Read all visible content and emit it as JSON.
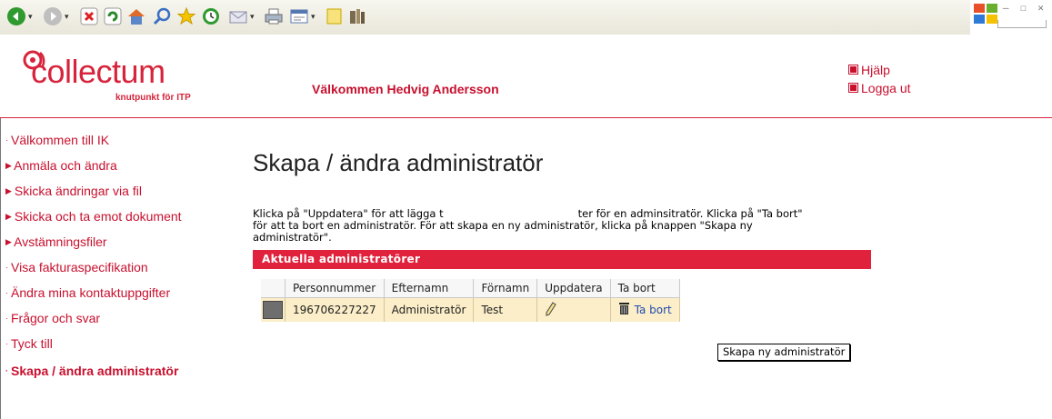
{
  "toolbar": {
    "icons": [
      "back-icon",
      "forward-icon",
      "stop-icon",
      "refresh-icon",
      "home-icon",
      "search-icon",
      "favorites-icon",
      "history-icon",
      "mail-icon",
      "print-icon",
      "edit-icon",
      "messenger-icon",
      "research-icon"
    ]
  },
  "header": {
    "logo_text": "collectum",
    "logo_tagline": "knutpunkt för ITP",
    "welcome": "Välkommen Hedvig Andersson",
    "help_link": "Hjälp",
    "logout_link": "Logga ut"
  },
  "sidebar": {
    "items": [
      {
        "label": "Välkommen till IK"
      },
      {
        "label": "Anmäla och ändra"
      },
      {
        "label": "Skicka ändringar via fil"
      },
      {
        "label": "Skicka och ta emot dokument"
      },
      {
        "label": "Avstämningsfiler"
      },
      {
        "label": "Visa fakturaspecifikation"
      },
      {
        "label": "Ändra mina kontaktuppgifter"
      },
      {
        "label": "Frågor och svar"
      },
      {
        "label": "Tyck till"
      },
      {
        "label": "Skapa / ändra administratör"
      }
    ]
  },
  "main": {
    "title": "Skapa / ändra administratör",
    "intro_line1a": "Klicka på \"Uppdatera\" för att lägga t",
    "intro_line1b": "ter för en adminsitratör. Klicka på \"Ta bort\"",
    "intro_line2": "för att ta bort en administratör. För att skapa en ny administratör, klicka på knappen \"Skapa ny",
    "intro_line3": "administratör\".",
    "section_title": "Aktuella administratörer",
    "table": {
      "headers": [
        "Personnummer",
        "Efternamn",
        "Förnamn",
        "Uppdatera",
        "Ta bort"
      ],
      "rows": [
        {
          "personnummer": "196706227227",
          "efternamn": "Administratör",
          "fornamn": "Test",
          "ta_bort": "Ta bort"
        }
      ]
    },
    "create_button": "Skapa ny administratör"
  },
  "colors": {
    "brand_red": "#d7243c",
    "row_highlight": "#fbeec8",
    "link_blue": "#1f4bb0"
  }
}
